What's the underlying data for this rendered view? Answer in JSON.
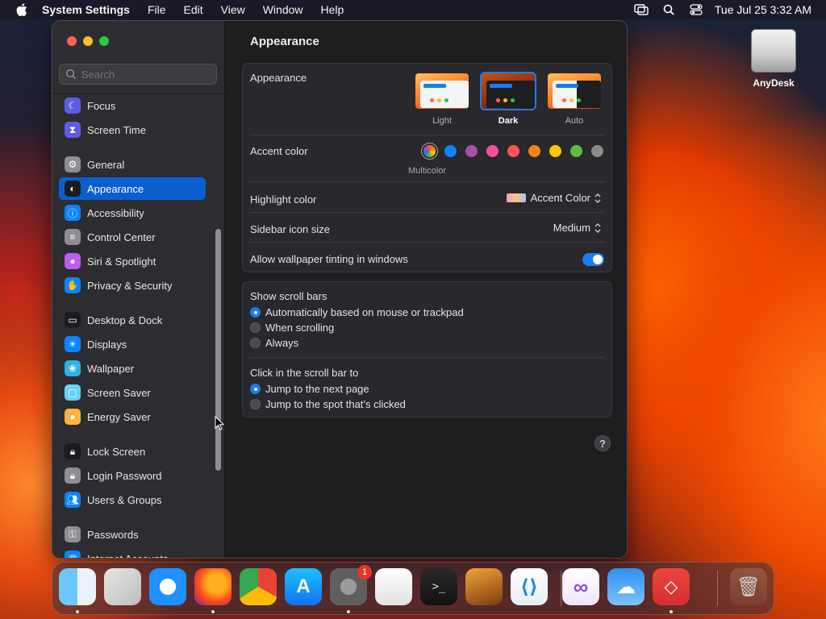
{
  "menubar": {
    "app_name": "System Settings",
    "menus": [
      "File",
      "Edit",
      "View",
      "Window",
      "Help"
    ],
    "clock": "Tue Jul 25  3:32 AM"
  },
  "desktop": {
    "drive_label": "AnyDesk"
  },
  "sidebar": {
    "search_placeholder": "Search",
    "items": [
      {
        "label": "Focus",
        "icon": "moon-icon",
        "color": "#5e5ce6"
      },
      {
        "label": "Screen Time",
        "icon": "hourglass-icon",
        "color": "#5e5ce6"
      },
      {
        "label": "General",
        "icon": "gear-icon",
        "color": "#8e8e93"
      },
      {
        "label": "Appearance",
        "icon": "appearance-icon",
        "color": "#1c1c1e"
      },
      {
        "label": "Accessibility",
        "icon": "accessibility-icon",
        "color": "#0a84ff"
      },
      {
        "label": "Control Center",
        "icon": "control-center-icon",
        "color": "#8e8e93"
      },
      {
        "label": "Siri & Spotlight",
        "icon": "siri-icon",
        "color": "#bf5af2"
      },
      {
        "label": "Privacy & Security",
        "icon": "hand-icon",
        "color": "#0a84ff"
      },
      {
        "label": "Desktop & Dock",
        "icon": "dock-icon",
        "color": "#1c1c1e"
      },
      {
        "label": "Displays",
        "icon": "sun-icon",
        "color": "#0a84ff"
      },
      {
        "label": "Wallpaper",
        "icon": "wallpaper-icon",
        "color": "#30b0e6"
      },
      {
        "label": "Screen Saver",
        "icon": "screen-saver-icon",
        "color": "#64d2ff"
      },
      {
        "label": "Energy Saver",
        "icon": "bulb-icon",
        "color": "#ffb340"
      },
      {
        "label": "Lock Screen",
        "icon": "lock-icon",
        "color": "#1c1c1e"
      },
      {
        "label": "Login Password",
        "icon": "lock-icon",
        "color": "#8e8e93"
      },
      {
        "label": "Users & Groups",
        "icon": "users-icon",
        "color": "#0a84ff"
      },
      {
        "label": "Passwords",
        "icon": "key-icon",
        "color": "#8e8e93"
      },
      {
        "label": "Internet Accounts",
        "icon": "at-icon",
        "color": "#0a84ff"
      }
    ],
    "selected_label": "Appearance"
  },
  "content": {
    "title": "Appearance",
    "appearance": {
      "label": "Appearance",
      "options": [
        "Light",
        "Dark",
        "Auto"
      ],
      "selected": "Dark"
    },
    "accent": {
      "label": "Accent color",
      "colors": [
        "multicolor",
        "#0a84ff",
        "#a550a7",
        "#f74f9e",
        "#ff5257",
        "#f7821b",
        "#ffc600",
        "#62ba46",
        "#8c8c8c"
      ],
      "selected_caption": "Multicolor"
    },
    "highlight": {
      "label": "Highlight color",
      "value": "Accent Color"
    },
    "sidebar_icon_size": {
      "label": "Sidebar icon size",
      "value": "Medium"
    },
    "wallpaper_tinting": {
      "label": "Allow wallpaper tinting in windows",
      "enabled": true
    },
    "scroll_bars": {
      "label": "Show scroll bars",
      "options": [
        "Automatically based on mouse or trackpad",
        "When scrolling",
        "Always"
      ],
      "selected": "Automatically based on mouse or trackpad"
    },
    "click_scroll": {
      "label": "Click in the scroll bar to",
      "options": [
        "Jump to the next page",
        "Jump to the spot that’s clicked"
      ],
      "selected": "Jump to the next page"
    },
    "help": "?"
  },
  "dock": {
    "apps": [
      {
        "name": "Finder",
        "icon": "finder-icon",
        "running": true
      },
      {
        "name": "Launchpad",
        "icon": "launchpad-icon",
        "running": false
      },
      {
        "name": "Safari",
        "icon": "safari-icon",
        "running": false
      },
      {
        "name": "Firefox",
        "icon": "firefox-icon",
        "running": true
      },
      {
        "name": "Chrome",
        "icon": "chrome-icon",
        "running": false
      },
      {
        "name": "App Store",
        "icon": "app-store-icon",
        "running": false
      },
      {
        "name": "System Settings",
        "icon": "system-settings-icon",
        "running": true,
        "badge": "1"
      },
      {
        "name": "TextEdit",
        "icon": "textedit-icon",
        "running": false
      },
      {
        "name": "Terminal",
        "icon": "terminal-icon",
        "running": false
      },
      {
        "name": "GarageBand",
        "icon": "garageband-icon",
        "running": false
      },
      {
        "name": "Visual Studio Code",
        "icon": "vscode-icon",
        "running": false
      },
      {
        "name": "Visual Studio",
        "icon": "visual-studio-icon",
        "running": false
      },
      {
        "name": "Weather",
        "icon": "weather-icon",
        "running": false
      },
      {
        "name": "AnyDesk",
        "icon": "anydesk-icon",
        "running": true
      },
      {
        "name": "Trash",
        "icon": "trash-icon",
        "running": false
      }
    ]
  }
}
